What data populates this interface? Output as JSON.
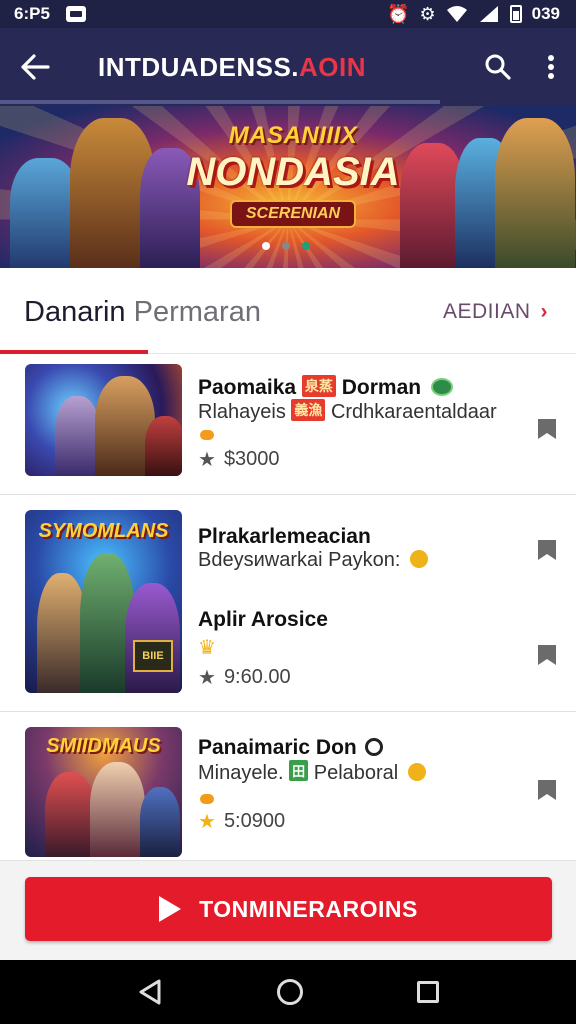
{
  "status_bar": {
    "time": "6:P5",
    "right_text": "039",
    "icons": [
      "notification-icon",
      "alarm-icon",
      "settings-gear-icon",
      "wifi-icon",
      "signal-icon",
      "battery-icon"
    ]
  },
  "app_bar": {
    "title_main": "INTDUADENSS.",
    "title_accent": "AOIN",
    "icons": [
      "back-arrow-icon",
      "search-icon",
      "more-vert-icon"
    ]
  },
  "banner": {
    "sup_title": "MASANIIIX",
    "title": "NONDASIA",
    "subtitle": "SCERENIAN",
    "dots": 3,
    "active_dot": 0
  },
  "section": {
    "title_main": "Danarin",
    "title_muted": "Permaran",
    "action_label": "AEDIIAN",
    "action_chevron": "›"
  },
  "items": [
    {
      "title": "Paomaika",
      "title_tag": "泉蒸",
      "title_tail": "Dorman",
      "subtitle": "Rlahayeis",
      "subtitle_tag": "義漁",
      "subtitle_tail": "Crdhkaraentaldaar",
      "price": "$3000",
      "thumb_logo": ""
    },
    {
      "title": "Plrakarlemeacian",
      "subtitle": "Bdeysиwarkai Paykon:",
      "title2": "Aplir Arosice",
      "price": "9:60.00",
      "thumb_logo": "SYMOMLANS",
      "thumb_sub": "BIIE"
    },
    {
      "title": "Panaimaric Don",
      "subtitle": "Minayele.",
      "subtitle_tag": "田",
      "subtitle_tail": "Pelaboral",
      "price": "5:0900",
      "thumb_logo": "SMIIDMAUS"
    }
  ],
  "cta": {
    "label": "TONMINERAROINS"
  },
  "colors": {
    "app_bar": "#282a55",
    "status_bar": "#1f2244",
    "accent_red": "#e31b2a",
    "star_gold": "#f2b31a"
  }
}
